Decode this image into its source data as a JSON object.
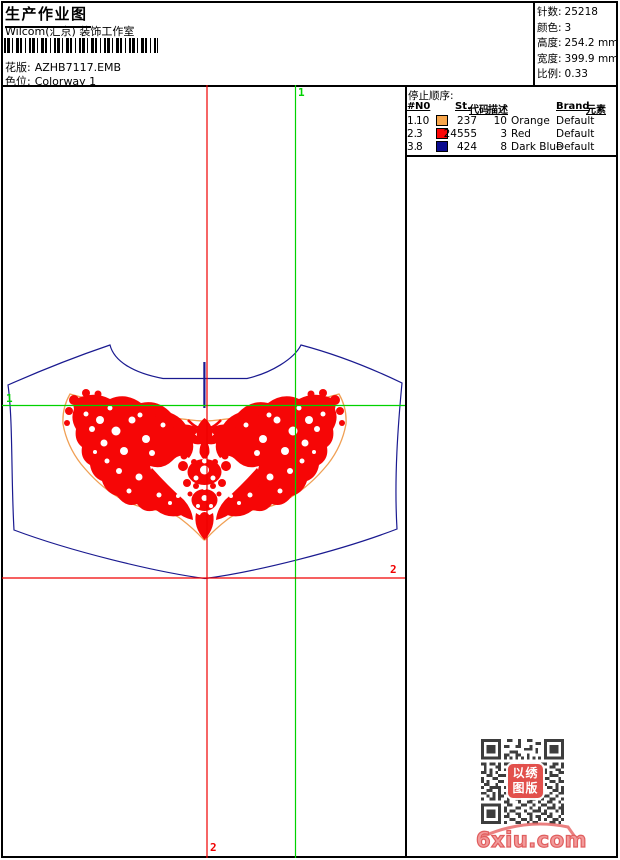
{
  "header": {
    "title": "生产作业图",
    "studio": "Wilcom(汇京) 装饰工作室",
    "design": {
      "label": "花版:",
      "value": "AZHB7117.EMB"
    },
    "colorway": {
      "label": "色位:",
      "value": "Colorway 1"
    }
  },
  "summary": {
    "rows": [
      {
        "label": "针数:",
        "value": "25218"
      },
      {
        "label": "颜色:",
        "value": "3"
      },
      {
        "label": "高度:",
        "value": "254.2 mm"
      },
      {
        "label": "宽度:",
        "value": "399.9 mm"
      },
      {
        "label": "比例:",
        "value": "0.33"
      }
    ]
  },
  "stop_sequence": {
    "title": "停止顺序:",
    "headers": {
      "stop": "#",
      "needle": "N0",
      "stitches": "St.",
      "code": "代码",
      "description": "描述",
      "brand": "Brand",
      "element": "元素"
    },
    "rows": [
      {
        "stop": "1.",
        "needle": "10",
        "color": "#f7a64c",
        "stitches": "237",
        "code": "10",
        "description": "Orange",
        "brand": "Default"
      },
      {
        "stop": "2.",
        "needle": "3",
        "color": "#fb0505",
        "stitches": "24555",
        "code": "3",
        "description": "Red",
        "brand": "Default"
      },
      {
        "stop": "3.",
        "needle": "8",
        "color": "#0b0b8f",
        "stitches": "424",
        "code": "8",
        "description": "Dark Blue",
        "brand": "Default"
      }
    ]
  },
  "guides": {
    "green_axis_label": "1",
    "red_axis_label": "2",
    "green_color": "#00d200",
    "red_color": "#f00000"
  },
  "design_colors": {
    "outline_navy": "#1a1a90",
    "border_orange": "#f0a055",
    "fill_red": "#f60606"
  },
  "watermark": {
    "site": "6xiu.com",
    "stamp_top": "以绣",
    "stamp_bottom": "图版"
  }
}
